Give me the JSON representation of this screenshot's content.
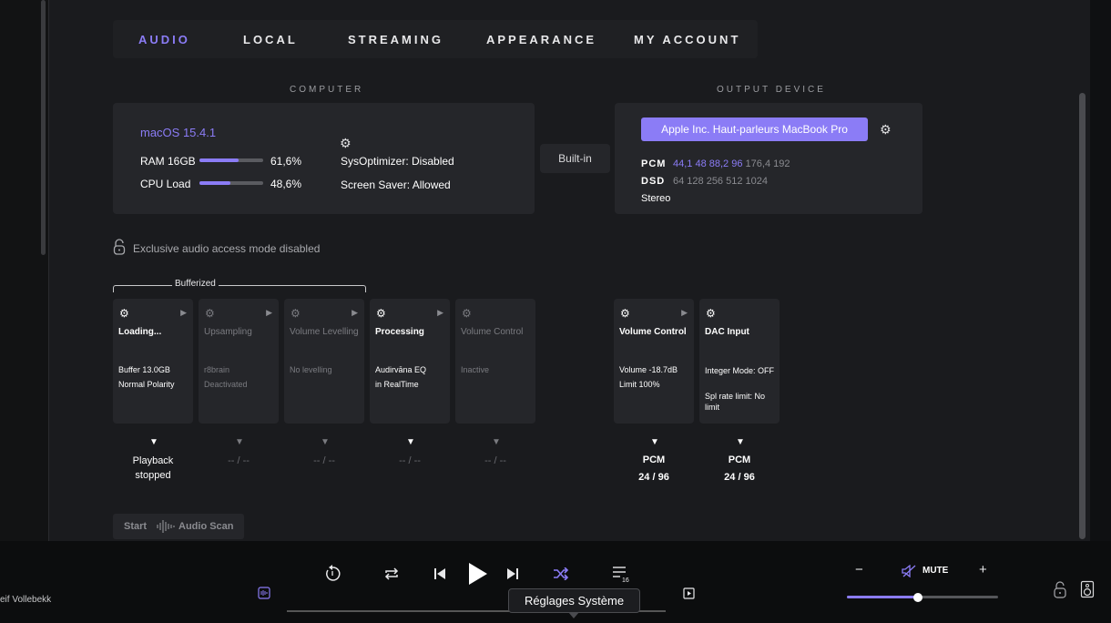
{
  "tabs": [
    {
      "label": "AUDIO",
      "active": true
    },
    {
      "label": "LOCAL",
      "active": false
    },
    {
      "label": "STREAMING",
      "active": false
    },
    {
      "label": "APPEARANCE",
      "active": false
    },
    {
      "label": "MY ACCOUNT",
      "active": false
    }
  ],
  "computer": {
    "section_label": "COMPUTER",
    "os": "macOS 15.4.1",
    "ram_label": "RAM 16GB",
    "ram_value": "61,6%",
    "ram_fraction": 0.616,
    "cpu_label": "CPU Load",
    "cpu_value": "48,6%",
    "cpu_fraction": 0.486,
    "sysoptimizer": "SysOptimizer: Disabled",
    "screensaver": "Screen Saver: Allowed"
  },
  "connection": "Built-in",
  "output": {
    "section_label": "OUTPUT DEVICE",
    "device": "Apple Inc. Haut-parleurs MacBook Pro",
    "pcm_key": "PCM",
    "pcm_supported": "44,1 48 88,2 96",
    "pcm_unsupported": "176,4 192",
    "dsd_key": "DSD",
    "dsd_unsupported": "64 128 256 512 1024",
    "channels": "Stereo"
  },
  "exclusive_mode": "Exclusive audio access mode disabled",
  "bufferized_label": "Bufferized",
  "pipeline": [
    {
      "title": "Loading...",
      "line1": "Buffer 13.0GB",
      "line2": "Normal Polarity",
      "under1": "Playback",
      "under2": "stopped",
      "active": true
    },
    {
      "title": "Upsampling",
      "line1": "r8brain",
      "line2": "Deactivated",
      "under1": "-- / --",
      "under2": "",
      "active": false
    },
    {
      "title": "Volume Levelling",
      "line1": "No levelling",
      "line2": "",
      "under1": "-- / --",
      "under2": "",
      "active": false
    },
    {
      "title": "Processing",
      "line1": "Audirvāna EQ",
      "line2": "in RealTime",
      "under1": "-- / --",
      "under2": "",
      "active": true
    },
    {
      "title": "Volume Control",
      "line1": "Inactive",
      "line2": "",
      "under1": "-- / --",
      "under2": "",
      "active": false
    }
  ],
  "output_pipeline": [
    {
      "title": "Volume Control",
      "line1": "Volume -18.7dB",
      "line2": "Limit 100%",
      "under1": "PCM",
      "under2": "24 / 96"
    },
    {
      "title": "DAC Input",
      "line1": "Integer Mode: OFF",
      "line2": "Spl rate limit: No limit",
      "under1": "PCM",
      "under2": "24 / 96"
    }
  ],
  "scan": {
    "start": "Start",
    "label": "Audio Scan"
  },
  "player": {
    "artist": "eif Vollebekk",
    "mute_label": "MUTE",
    "minus": "−",
    "plus": "+",
    "volume_fraction": 0.47,
    "tooltip": "Réglages Système",
    "queue_count": "16"
  },
  "icons": {
    "gear": "⚙",
    "play_small": "▶",
    "arrow_down": "▼"
  },
  "colors": {
    "accent": "#8b7cf6"
  }
}
